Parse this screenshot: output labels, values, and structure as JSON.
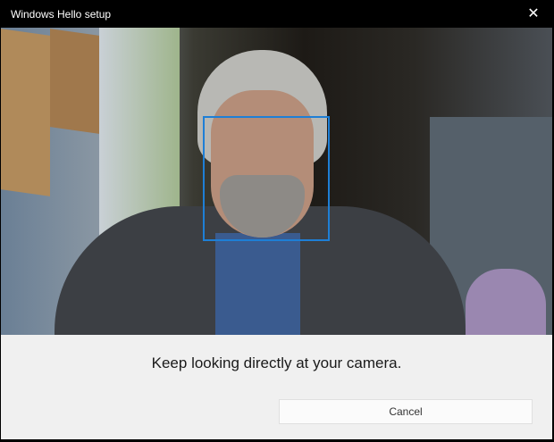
{
  "window": {
    "title": "Windows Hello setup",
    "close_icon": "close-icon"
  },
  "camera": {
    "face_box_color": "#1e7fd6"
  },
  "panel": {
    "message": "Keep looking directly at your camera.",
    "cancel_label": "Cancel"
  }
}
